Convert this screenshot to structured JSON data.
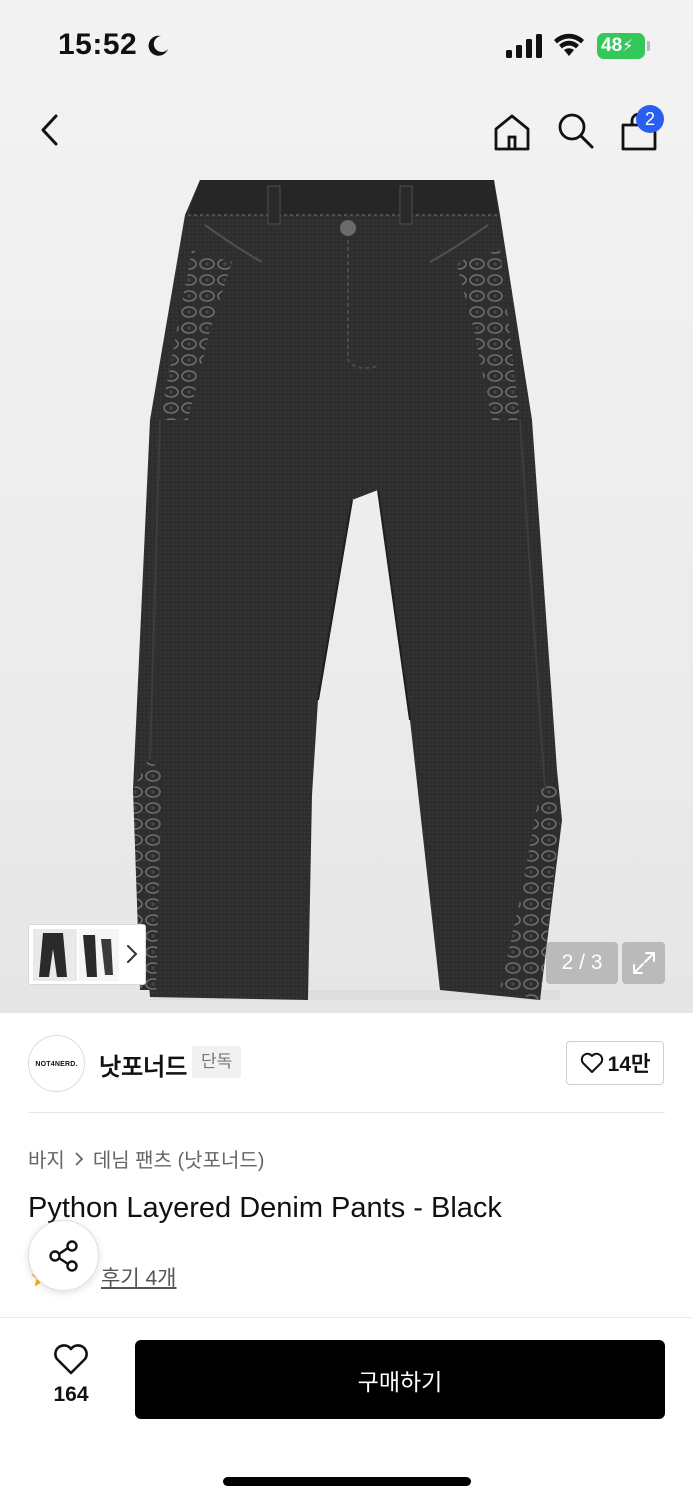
{
  "status_bar": {
    "time": "15:52",
    "battery": "48",
    "icons": [
      "moon-icon",
      "signal-icon",
      "wifi-icon",
      "battery-icon"
    ]
  },
  "nav": {
    "icons": [
      "back-icon",
      "home-icon",
      "search-icon",
      "bag-icon"
    ],
    "cart_count": "2"
  },
  "gallery": {
    "counter": "2 / 3",
    "current": 2,
    "total": 3
  },
  "brand": {
    "logo_text": "NOT4NERD.",
    "name": "낫포너드",
    "tag": "단독",
    "likes": "14만"
  },
  "breadcrumb": {
    "category": "바지",
    "subcategory": "데님 팬츠 (낫포너드)"
  },
  "product": {
    "title": "Python Layered Denim Pants - Black",
    "reviews": "후기 4개"
  },
  "bottom": {
    "wish_count": "164",
    "buy_label": "구매하기"
  },
  "colors": {
    "accent_blue": "#2a5ef0",
    "battery_green": "#34c759",
    "buy_button": "#000000"
  }
}
